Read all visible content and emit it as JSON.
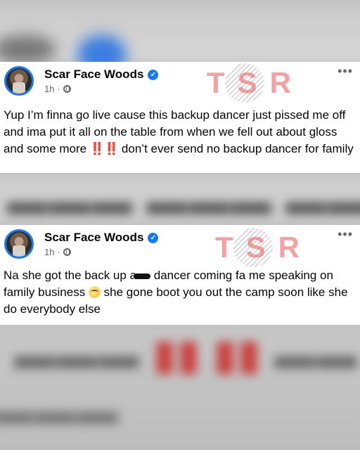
{
  "posts": [
    {
      "author": "Scar Face Woods",
      "time": "1h",
      "dot": "·",
      "verified_icon": "verified-badge-icon",
      "privacy_icon": "globe-icon",
      "more_label": "•••",
      "watermark": "TSR",
      "text_before": "Yup I’m finna go live cause this backup dancer just pissed me off and ima put it all on the table from when we fell out about gloss and some more ",
      "emphasis": "‼️‼️",
      "text_after": "don’t ever send no backup dancer for family"
    },
    {
      "author": "Scar Face Woods",
      "time": "1h",
      "dot": "·",
      "verified_icon": "verified-badge-icon",
      "privacy_icon": "globe-icon",
      "more_label": "•••",
      "watermark": "TSR",
      "text_part1": "Na she got the back up a",
      "text_part2": " dancer coming fa me speaking on family business ",
      "text_part3": "she gone boot you out the camp soon like she do everybody else"
    }
  ],
  "colors": {
    "verified": "#1877f2",
    "watermark": "#ea6464",
    "text": "#050505",
    "meta": "#65676b"
  }
}
